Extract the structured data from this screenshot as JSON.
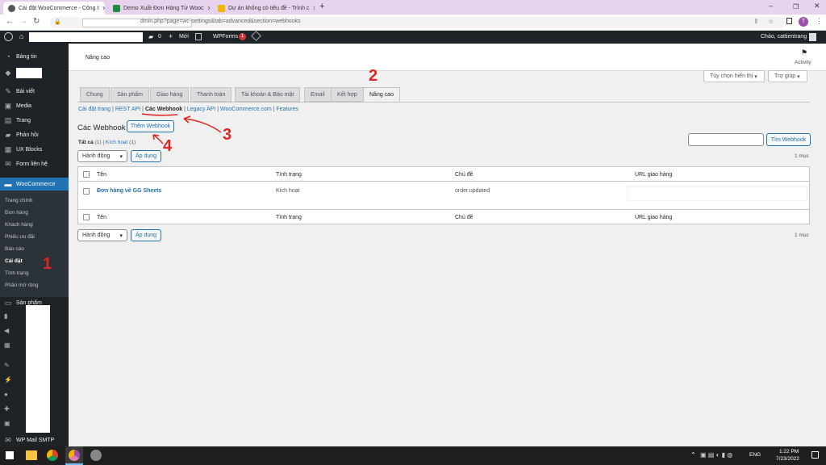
{
  "browser": {
    "tabs": [
      {
        "title": "Cài đặt WooCommerce - Công t"
      },
      {
        "title": "Demo Xuất Đơn Hàng Từ Wooc"
      },
      {
        "title": "Dự án không có tiêu đề - Trình c"
      }
    ],
    "new_tab": "+",
    "url": "dmin.php?page=wc-settings&tab=advanced&section=webhooks",
    "profile_initial": "T"
  },
  "adminbar": {
    "comments_count": "0",
    "new_label": "Mới",
    "wpforms_label": "WPForms",
    "wpforms_badge": "1",
    "greeting": "Chào, cattientrang"
  },
  "sidebar": {
    "dashboard": "Bảng tin",
    "posts": "Bài viết",
    "media": "Media",
    "pages": "Trang",
    "comments": "Phản hồi",
    "uxblocks": "UX Blocks",
    "forms": "Form liên hệ",
    "woocommerce": "WooCommerce",
    "woo_sub": [
      "Trang chính",
      "Đơn hàng",
      "Khách hàng",
      "Phiếu ưu đãi",
      "Báo cáo",
      "Cài đặt",
      "Tình trạng",
      "Phần mở rộng"
    ],
    "products": "Sản phẩm",
    "wpmail": "WP Mail SMTP"
  },
  "header": {
    "page_title": "Nâng cao",
    "activity": "Activity",
    "screen_options": "Tùy chọn hiển thị",
    "help": "Trợ giúp"
  },
  "tabs": [
    "Chung",
    "Sản phẩm",
    "Giao hàng",
    "Thanh toán",
    "Tài khoản & Bảo mật",
    "Email",
    "Kết hợp",
    "Nâng cao"
  ],
  "subnav": [
    "Cài đặt trang",
    "REST API",
    "Các Webhook",
    "Legacy API",
    "WooCommerce.com",
    "Features"
  ],
  "subnav_sep": "|",
  "section": {
    "title": "Các Webhook",
    "add_button": "Thêm Webhook",
    "filter_all": "Tất cả",
    "filter_all_count": "(1)",
    "filter_sep": "|",
    "filter_active": "Kích hoạt",
    "filter_active_count": "(1)",
    "search_placeholder": "",
    "search_button": "Tìm Webhook",
    "items_count": "1 mục",
    "bulk_action": "Hành động",
    "apply": "Áp dụng"
  },
  "table": {
    "headers": [
      "Tên",
      "Tình trạng",
      "Chủ đề",
      "URL giao hàng"
    ],
    "rows": [
      {
        "name": "Đơn hàng về GG Sheets",
        "status": "Kích hoạt",
        "topic": "order.updated",
        "url": ""
      }
    ]
  },
  "annotations": [
    "1",
    "2",
    "3",
    "4"
  ],
  "taskbar": {
    "lang": "ENG",
    "time": "1:22 PM",
    "date": "7/23/2022"
  },
  "colors": {
    "wp_blue": "#2271b1",
    "admin_dark": "#1d2327",
    "annotation_red": "#e02424",
    "chrome_tabbar": "#e8d3ee"
  }
}
